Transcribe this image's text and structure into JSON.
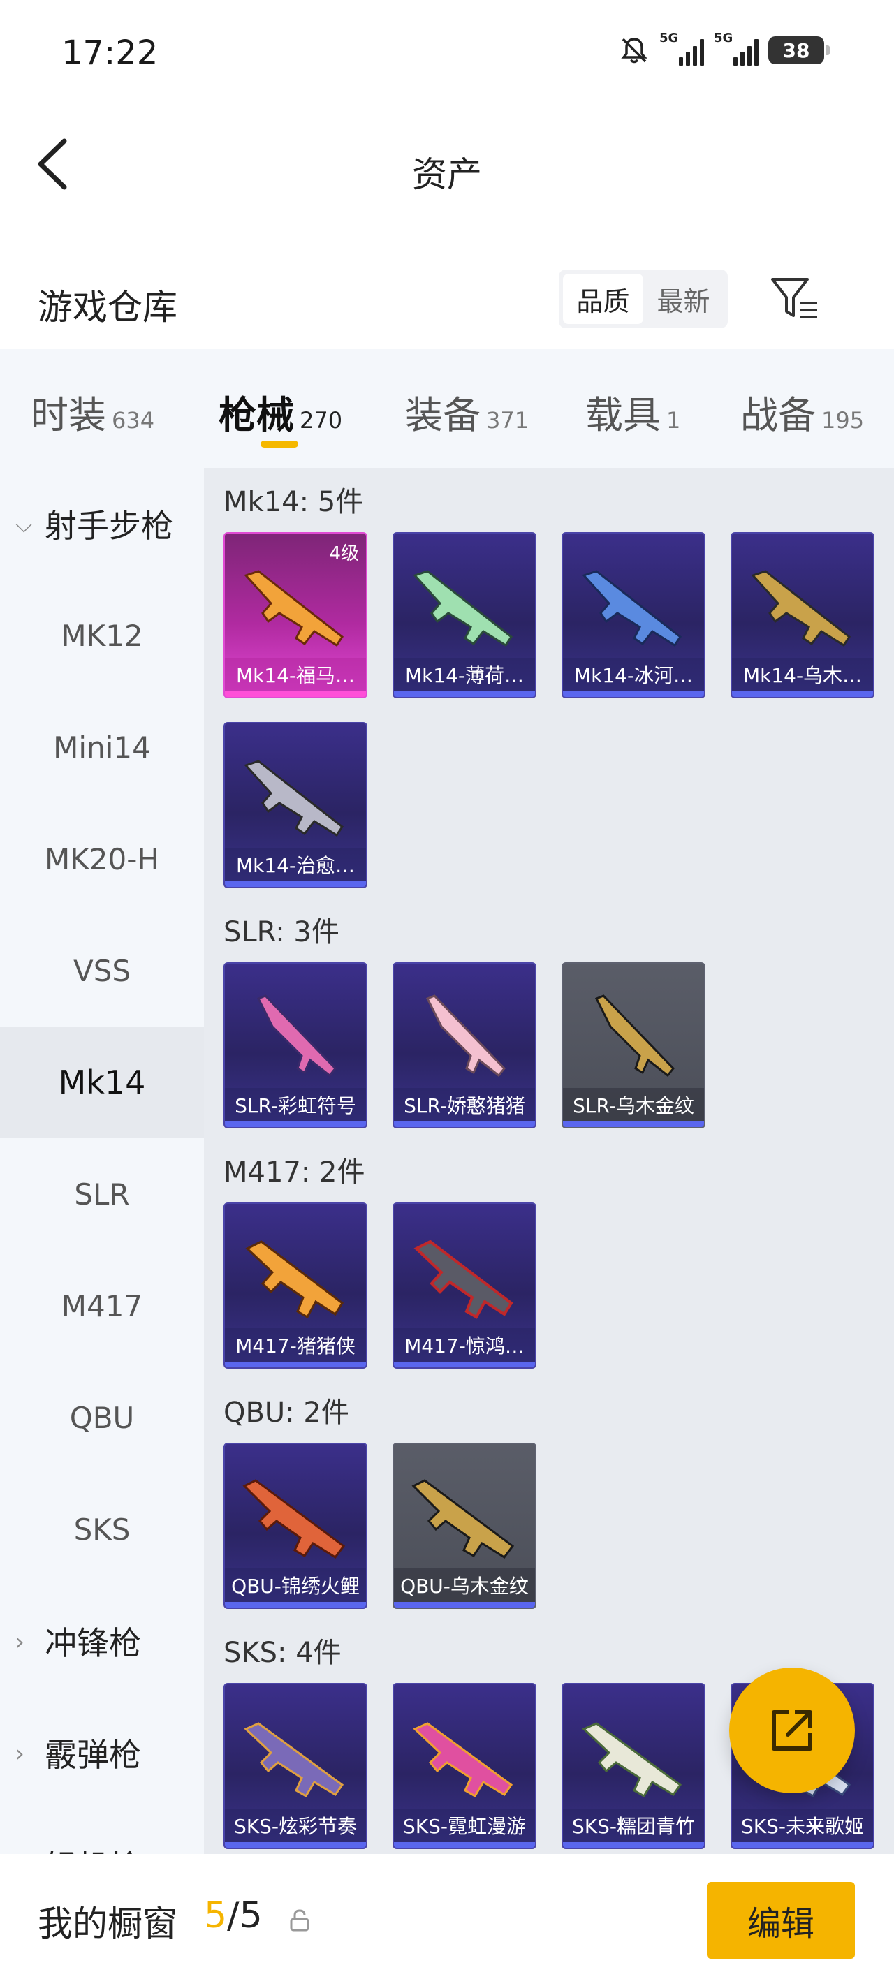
{
  "status": {
    "time": "17:22",
    "signal_labels": [
      "5G",
      "5G"
    ],
    "battery": "38"
  },
  "header": {
    "title": "资产"
  },
  "section": {
    "title": "游戏仓库",
    "sort_options": [
      "品质",
      "最新"
    ],
    "sort_selected": "品质"
  },
  "tabs": [
    {
      "label": "时装",
      "count": "634"
    },
    {
      "label": "枪械",
      "count": "270",
      "active": true
    },
    {
      "label": "装备",
      "count": "371"
    },
    {
      "label": "载具",
      "count": "1"
    },
    {
      "label": "战备",
      "count": "195"
    }
  ],
  "sidebar": {
    "group_expanded": "射手步枪",
    "items": [
      "MK12",
      "Mini14",
      "MK20-H",
      "VSS",
      "Mk14",
      "SLR",
      "M417",
      "QBU",
      "SKS"
    ],
    "selected": "Mk14",
    "groups_collapsed": [
      "冲锋枪",
      "霰弹枪",
      "轻机枪"
    ]
  },
  "content": {
    "groups": [
      {
        "title": "Mk14: 5件",
        "cards": [
          {
            "label": "Mk14-福马…",
            "level": "4级",
            "style": "pink"
          },
          {
            "label": "Mk14-薄荷…",
            "style": "purple"
          },
          {
            "label": "Mk14-冰河…",
            "style": "purple"
          },
          {
            "label": "Mk14-乌木…",
            "style": "purple"
          },
          {
            "label": "Mk14-治愈…",
            "style": "purple"
          }
        ]
      },
      {
        "title": "SLR: 3件",
        "cards": [
          {
            "label": "SLR-彩虹符号",
            "style": "purple"
          },
          {
            "label": "SLR-娇憨猪猪",
            "style": "purple"
          },
          {
            "label": "SLR-乌木金纹",
            "style": "grey"
          }
        ]
      },
      {
        "title": "M417: 2件",
        "cards": [
          {
            "label": "M417-猪猪侠",
            "style": "purple"
          },
          {
            "label": "M417-惊鸿…",
            "style": "purple"
          }
        ]
      },
      {
        "title": "QBU: 2件",
        "cards": [
          {
            "label": "QBU-锦绣火鲤",
            "style": "purple"
          },
          {
            "label": "QBU-乌木金纹",
            "style": "grey"
          }
        ]
      },
      {
        "title": "SKS: 4件",
        "cards": [
          {
            "label": "SKS-炫彩节奏",
            "style": "purple"
          },
          {
            "label": "SKS-霓虹漫游",
            "style": "purple"
          },
          {
            "label": "SKS-糯团青竹",
            "style": "purple"
          },
          {
            "label": "SKS-未来歌姬",
            "style": "purple"
          }
        ]
      }
    ]
  },
  "showcase": {
    "title": "我的橱窗",
    "current": "5",
    "total": "/5",
    "edit_label": "编辑"
  },
  "colors": {
    "accent": "#f5b400",
    "rarity_pink": "#e04bd3",
    "rarity_purple": "#4a44a8",
    "rarity_grey": "#5e6170"
  }
}
